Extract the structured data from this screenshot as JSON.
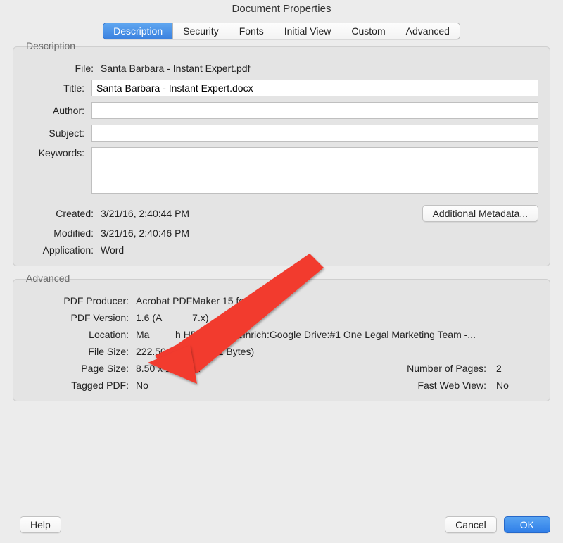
{
  "window": {
    "title": "Document Properties"
  },
  "tabs": [
    "Description",
    "Security",
    "Fonts",
    "Initial View",
    "Custom",
    "Advanced"
  ],
  "selectedTab": 0,
  "description": {
    "legend": "Description",
    "labels": {
      "file": "File:",
      "title": "Title:",
      "author": "Author:",
      "subject": "Subject:",
      "keywords": "Keywords:",
      "created": "Created:",
      "modified": "Modified:",
      "application": "Application:"
    },
    "file": "Santa Barbara - Instant Expert.pdf",
    "title": "Santa Barbara - Instant Expert.docx",
    "author": "",
    "subject": "",
    "keywords": "",
    "created": "3/21/16, 2:40:44 PM",
    "modified": "3/21/16, 2:40:46 PM",
    "application": "Word",
    "additionalMetadataButton": "Additional Metadata..."
  },
  "advanced": {
    "legend": "Advanced",
    "labels": {
      "producer": "PDF Producer:",
      "version": "PDF Version:",
      "location": "Location:",
      "filesize": "File Size:",
      "pagesize": "Page Size:",
      "tagged": "Tagged PDF:",
      "numpages": "Number of Pages:",
      "fastweb": "Fast Web View:"
    },
    "producer": "Acrobat PDFMaker 15 for Word",
    "version_partial_left": "1.6 (A",
    "version_partial_right": "7.x)",
    "location_partial_left": "Ma",
    "location_partial_right": "h HD:Users:rheinrich:Google Drive:#1 One Legal Marketing Team -...",
    "filesize": "222.50 KB (227,841 Bytes)",
    "pagesize": "8.50 x 10.99 in",
    "numpages": "2",
    "tagged": "No",
    "fastweb": "No"
  },
  "footer": {
    "help": "Help",
    "cancel": "Cancel",
    "ok": "OK"
  }
}
